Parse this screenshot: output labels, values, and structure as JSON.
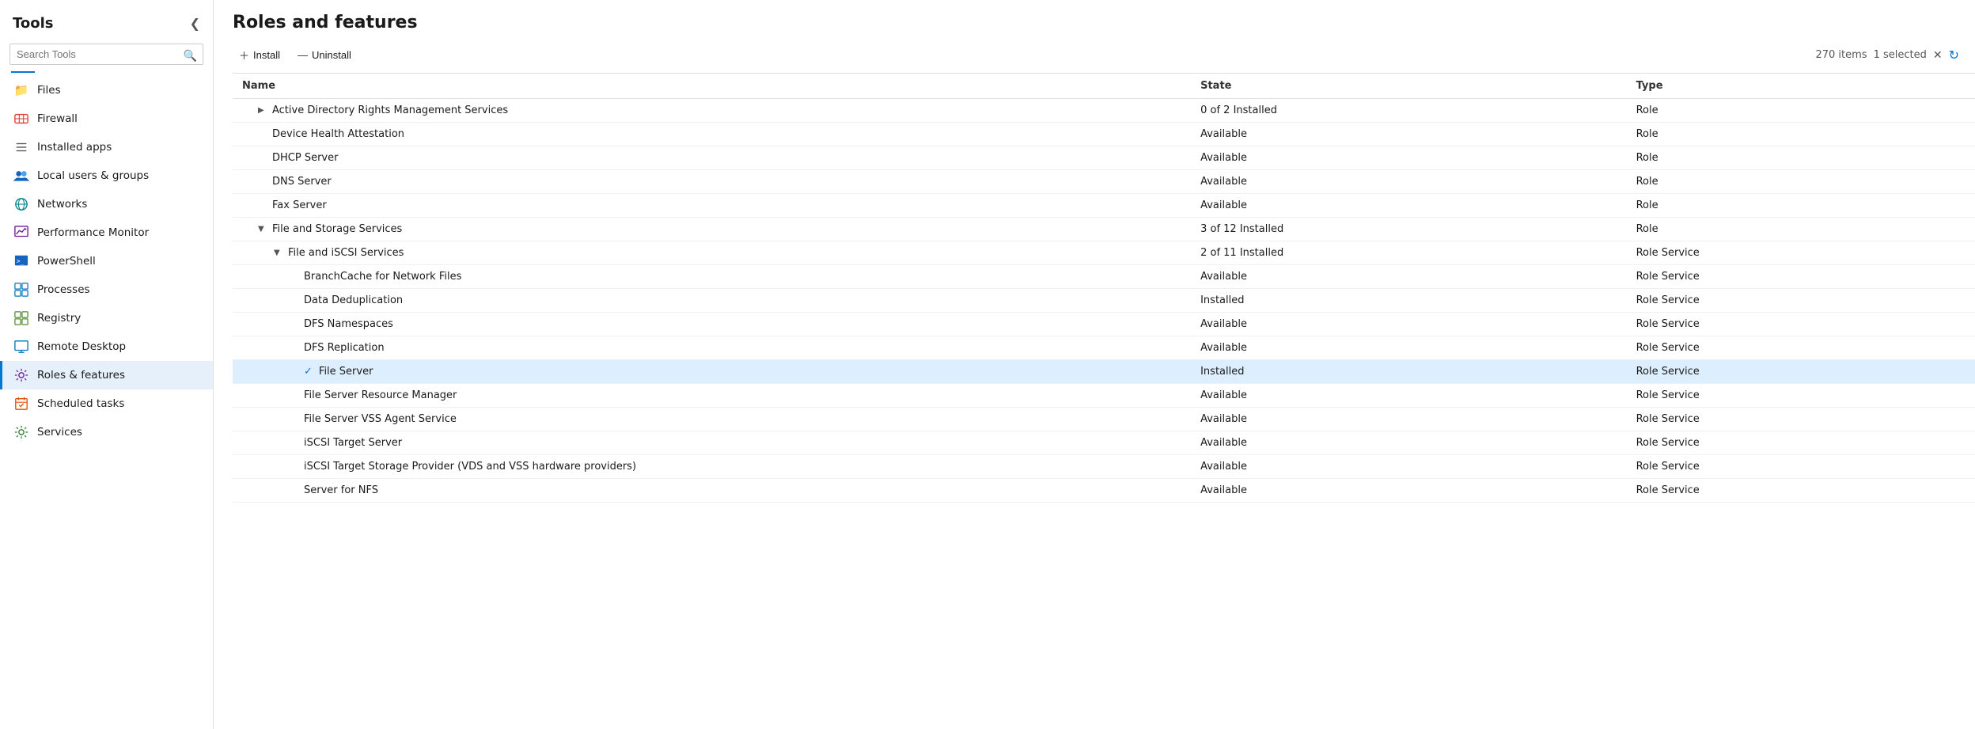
{
  "sidebar": {
    "title": "Tools",
    "search_placeholder": "Search Tools",
    "collapse_icon": "❮",
    "divider_color": "#0078d4",
    "items": [
      {
        "id": "files",
        "label": "Files",
        "icon": "📁",
        "icon_color": "#f9a825",
        "active": false
      },
      {
        "id": "firewall",
        "label": "Firewall",
        "icon": "🔥",
        "icon_color": "#e53935",
        "active": false
      },
      {
        "id": "installed-apps",
        "label": "Installed apps",
        "icon": "☰",
        "icon_color": "#555",
        "active": false
      },
      {
        "id": "local-users",
        "label": "Local users & groups",
        "icon": "👥",
        "icon_color": "#1565c0",
        "active": false
      },
      {
        "id": "networks",
        "label": "Networks",
        "icon": "🌐",
        "icon_color": "#00838f",
        "active": false
      },
      {
        "id": "performance-monitor",
        "label": "Performance Monitor",
        "icon": "📊",
        "icon_color": "#6a1b9a",
        "active": false
      },
      {
        "id": "powershell",
        "label": "PowerShell",
        "icon": "🖥",
        "icon_color": "#1565c0",
        "active": false
      },
      {
        "id": "processes",
        "label": "Processes",
        "icon": "⊞",
        "icon_color": "#0277bd",
        "active": false
      },
      {
        "id": "registry",
        "label": "Registry",
        "icon": "⊞",
        "icon_color": "#558b2f",
        "active": false
      },
      {
        "id": "remote-desktop",
        "label": "Remote Desktop",
        "icon": "🖥",
        "icon_color": "#0277bd",
        "active": false
      },
      {
        "id": "roles-features",
        "label": "Roles & features",
        "icon": "⚙",
        "icon_color": "#6a1b9a",
        "active": true
      },
      {
        "id": "scheduled-tasks",
        "label": "Scheduled tasks",
        "icon": "🕐",
        "icon_color": "#e65100",
        "active": false
      },
      {
        "id": "services",
        "label": "Services",
        "icon": "⚙",
        "icon_color": "#2e7d32",
        "active": false
      }
    ]
  },
  "main": {
    "page_title": "Roles and features",
    "toolbar": {
      "install_label": "Install",
      "uninstall_label": "Uninstall",
      "items_count": "270 items",
      "selected_count": "1 selected"
    },
    "table": {
      "columns": [
        {
          "id": "name",
          "label": "Name"
        },
        {
          "id": "state",
          "label": "State"
        },
        {
          "id": "type",
          "label": "Type"
        }
      ],
      "rows": [
        {
          "id": 1,
          "indent": 1,
          "expand": "▶",
          "name": "Active Directory Rights Management Services",
          "state": "0 of 2 Installed",
          "type": "Role",
          "selected": false,
          "checked": false
        },
        {
          "id": 2,
          "indent": 1,
          "expand": "",
          "name": "Device Health Attestation",
          "state": "Available",
          "type": "Role",
          "selected": false,
          "checked": false
        },
        {
          "id": 3,
          "indent": 1,
          "expand": "",
          "name": "DHCP Server",
          "state": "Available",
          "type": "Role",
          "selected": false,
          "checked": false
        },
        {
          "id": 4,
          "indent": 1,
          "expand": "",
          "name": "DNS Server",
          "state": "Available",
          "type": "Role",
          "selected": false,
          "checked": false
        },
        {
          "id": 5,
          "indent": 1,
          "expand": "",
          "name": "Fax Server",
          "state": "Available",
          "type": "Role",
          "selected": false,
          "checked": false
        },
        {
          "id": 6,
          "indent": 1,
          "expand": "▼",
          "name": "File and Storage Services",
          "state": "3 of 12 Installed",
          "type": "Role",
          "selected": false,
          "checked": false
        },
        {
          "id": 7,
          "indent": 2,
          "expand": "▼",
          "name": "File and iSCSI Services",
          "state": "2 of 11 Installed",
          "type": "Role Service",
          "selected": false,
          "checked": false
        },
        {
          "id": 8,
          "indent": 3,
          "expand": "",
          "name": "BranchCache for Network Files",
          "state": "Available",
          "type": "Role Service",
          "selected": false,
          "checked": false
        },
        {
          "id": 9,
          "indent": 3,
          "expand": "",
          "name": "Data Deduplication",
          "state": "Installed",
          "type": "Role Service",
          "selected": false,
          "checked": false
        },
        {
          "id": 10,
          "indent": 3,
          "expand": "",
          "name": "DFS Namespaces",
          "state": "Available",
          "type": "Role Service",
          "selected": false,
          "checked": false
        },
        {
          "id": 11,
          "indent": 3,
          "expand": "",
          "name": "DFS Replication",
          "state": "Available",
          "type": "Role Service",
          "selected": false,
          "checked": false
        },
        {
          "id": 12,
          "indent": 3,
          "expand": "",
          "name": "File Server",
          "state": "Installed",
          "type": "Role Service",
          "selected": true,
          "checked": true
        },
        {
          "id": 13,
          "indent": 3,
          "expand": "",
          "name": "File Server Resource Manager",
          "state": "Available",
          "type": "Role Service",
          "selected": false,
          "checked": false
        },
        {
          "id": 14,
          "indent": 3,
          "expand": "",
          "name": "File Server VSS Agent Service",
          "state": "Available",
          "type": "Role Service",
          "selected": false,
          "checked": false
        },
        {
          "id": 15,
          "indent": 3,
          "expand": "",
          "name": "iSCSI Target Server",
          "state": "Available",
          "type": "Role Service",
          "selected": false,
          "checked": false
        },
        {
          "id": 16,
          "indent": 3,
          "expand": "",
          "name": "iSCSI Target Storage Provider (VDS and VSS hardware providers)",
          "state": "Available",
          "type": "Role Service",
          "selected": false,
          "checked": false
        },
        {
          "id": 17,
          "indent": 3,
          "expand": "",
          "name": "Server for NFS",
          "state": "Available",
          "type": "Role Service",
          "selected": false,
          "checked": false
        }
      ]
    }
  }
}
